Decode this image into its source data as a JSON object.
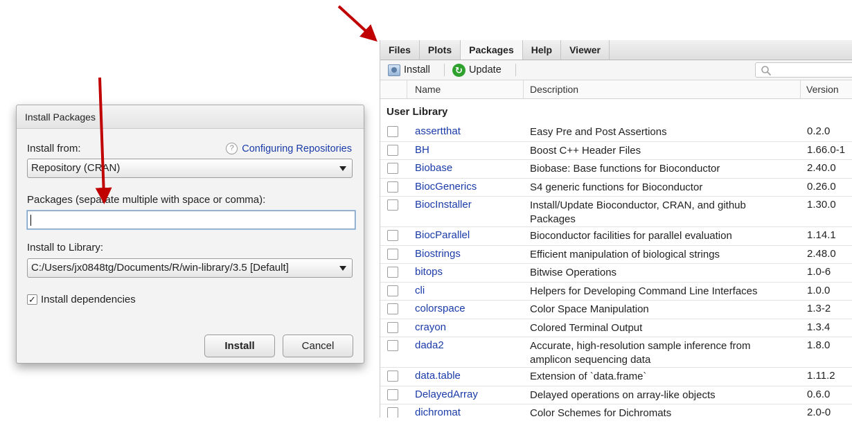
{
  "dialog": {
    "title": "Install Packages",
    "install_from_label": "Install from:",
    "help_link": "Configuring Repositories",
    "help_icon": "?",
    "install_from_value": "Repository (CRAN)",
    "packages_label": "Packages (separate multiple with space or comma):",
    "packages_value": "",
    "library_label": "Install to Library:",
    "library_value": "C:/Users/jx0848tg/Documents/R/win-library/3.5 [Default]",
    "dependencies_label": "Install dependencies",
    "dependencies_checked": true,
    "install_button": "Install",
    "cancel_button": "Cancel"
  },
  "pane": {
    "tabs": [
      "Files",
      "Plots",
      "Packages",
      "Help",
      "Viewer"
    ],
    "active_tab": "Packages",
    "toolbar": {
      "install": "Install",
      "update": "Update"
    },
    "columns": {
      "name": "Name",
      "description": "Description",
      "version": "Version"
    },
    "section": "User Library",
    "packages": [
      {
        "name": "assertthat",
        "description": "Easy Pre and Post Assertions",
        "version": "0.2.0"
      },
      {
        "name": "BH",
        "description": "Boost C++ Header Files",
        "version": "1.66.0-1"
      },
      {
        "name": "Biobase",
        "description": "Biobase: Base functions for Bioconductor",
        "version": "2.40.0"
      },
      {
        "name": "BiocGenerics",
        "description": "S4 generic functions for Bioconductor",
        "version": "0.26.0"
      },
      {
        "name": "BiocInstaller",
        "description": "Install/Update Bioconductor, CRAN, and github Packages",
        "version": "1.30.0"
      },
      {
        "name": "BiocParallel",
        "description": "Bioconductor facilities for parallel evaluation",
        "version": "1.14.1"
      },
      {
        "name": "Biostrings",
        "description": "Efficient manipulation of biological strings",
        "version": "2.48.0"
      },
      {
        "name": "bitops",
        "description": "Bitwise Operations",
        "version": "1.0-6"
      },
      {
        "name": "cli",
        "description": "Helpers for Developing Command Line Interfaces",
        "version": "1.0.0"
      },
      {
        "name": "colorspace",
        "description": "Color Space Manipulation",
        "version": "1.3-2"
      },
      {
        "name": "crayon",
        "description": "Colored Terminal Output",
        "version": "1.3.4"
      },
      {
        "name": "dada2",
        "description": "Accurate, high-resolution sample inference from amplicon sequencing data",
        "version": "1.8.0"
      },
      {
        "name": "data.table",
        "description": "Extension of `data.frame`",
        "version": "1.11.2"
      },
      {
        "name": "DelayedArray",
        "description": "Delayed operations on array-like objects",
        "version": "0.6.0"
      },
      {
        "name": "dichromat",
        "description": "Color Schemes for Dichromats",
        "version": "2.0-0"
      }
    ]
  },
  "colors": {
    "link": "#1a3ba8",
    "arrow": "#c00000",
    "update_green": "#2ea12e"
  }
}
